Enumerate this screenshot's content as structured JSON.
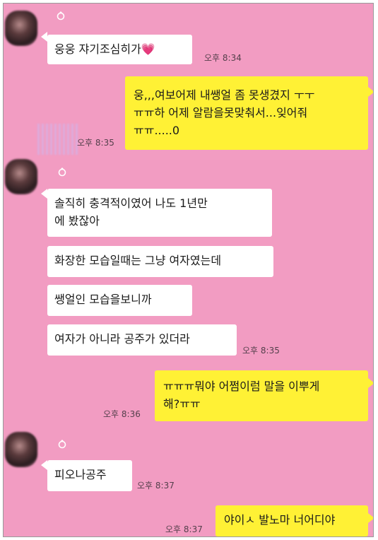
{
  "messages": [
    {
      "side": "left",
      "text": "웅웅 쟈기조심히가💗",
      "time": "오후 8:34"
    },
    {
      "side": "right",
      "line1": "웅,,,여보어제 내쌩얼 좀 못생겼지 ㅜㅜ",
      "line2": "ㅠㅠ하 어제 알람을못맞춰서...잊어줘",
      "line3": "ㅠㅠ.....0",
      "time": "오후 8:35"
    },
    {
      "side": "left",
      "line1": "솔직히 충격적이였어 나도 1년만",
      "line2": "에 봤잖아"
    },
    {
      "side": "left",
      "text": "화장한 모습일때는 그냥 여자였는데"
    },
    {
      "side": "left",
      "text": "쌩얼인 모습을보니까"
    },
    {
      "side": "left",
      "text": "여자가 아니라 공주가 있더라",
      "time": "오후 8:35"
    },
    {
      "side": "right",
      "line1": "ㅠㅠㅠ뭐야 어쩜이럼 말을 이뿌게",
      "line2": "해?ㅠㅠ",
      "time": "오후 8:36"
    },
    {
      "side": "left",
      "text": "피오나공주",
      "time": "오후 8:37"
    },
    {
      "side": "right",
      "text": "야이ㅅ 발노마 너어디야",
      "time": "오후 8:37"
    }
  ]
}
